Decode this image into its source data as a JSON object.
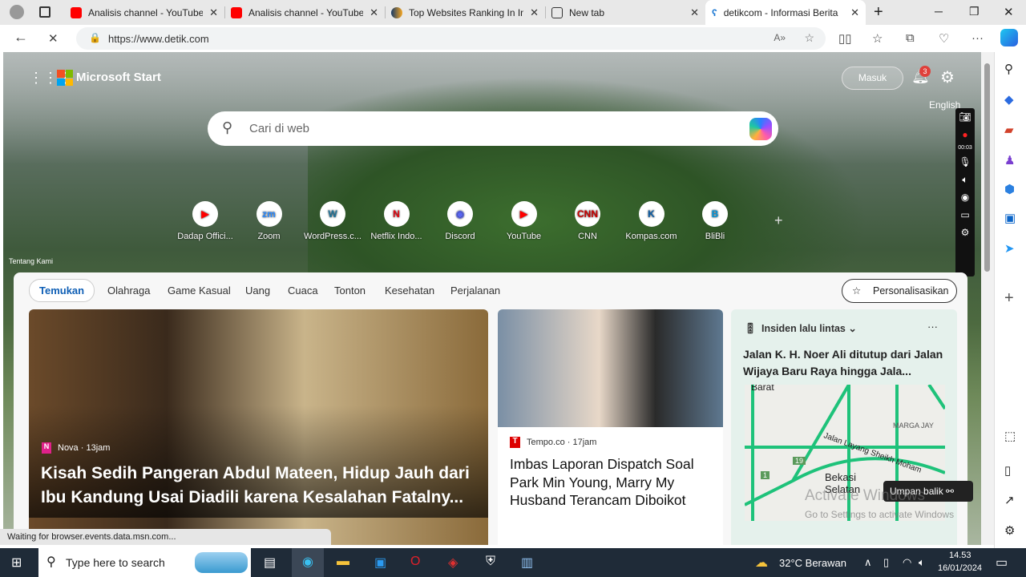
{
  "tabs": [
    {
      "title": "Analisis channel - YouTube S",
      "icon": "youtube-icon"
    },
    {
      "title": "Analisis channel - YouTube S",
      "icon": "youtube-icon"
    },
    {
      "title": "Top Websites Ranking In Ind",
      "icon": "similarweb-icon"
    },
    {
      "title": "New tab",
      "icon": "newtab-icon"
    },
    {
      "title": "detikcom - Informasi Berita",
      "icon": "detik-icon"
    }
  ],
  "address": {
    "url": "https://www.detik.com"
  },
  "start": {
    "brand": "Microsoft Start",
    "signin": "Masuk",
    "notif_count": "3",
    "language": "English",
    "search_placeholder": "Cari di web",
    "about": "Tentang Kami"
  },
  "quicklinks": [
    {
      "label": "Dadap Offici...",
      "glyph": "▶",
      "color": "#ff0000"
    },
    {
      "label": "Zoom",
      "glyph": "zm",
      "color": "#2d8cff"
    },
    {
      "label": "WordPress.c...",
      "glyph": "W",
      "color": "#21759b"
    },
    {
      "label": "Netflix Indo...",
      "glyph": "N",
      "color": "#e50914"
    },
    {
      "label": "Discord",
      "glyph": "◉",
      "color": "#5865f2"
    },
    {
      "label": "YouTube",
      "glyph": "▶",
      "color": "#ff0000"
    },
    {
      "label": "CNN",
      "glyph": "CNN",
      "color": "#cc0000"
    },
    {
      "label": "Kompas.com",
      "glyph": "K",
      "color": "#0b5ea8"
    },
    {
      "label": "BliBli",
      "glyph": "B",
      "color": "#0095da"
    }
  ],
  "recorder": {
    "timer": "00:03"
  },
  "feed": {
    "tabs": [
      "Temukan",
      "Olahraga",
      "Game Kasual",
      "Uang",
      "Cuaca",
      "Tonton",
      "Kesehatan",
      "Perjalanan"
    ],
    "personalize": "Personalisasikan",
    "main": {
      "source": "Nova · 13jam",
      "title": "Kisah Sedih Pangeran Abdul Mateen, Hidup Jauh dari Ibu Kandung Usai Diadili karena Kesalahan Fatalny..."
    },
    "second": {
      "source": "Tempo.co · 17jam",
      "title": "Imbas Laporan Dispatch Soal Park Min Young, Marry My Husband Terancam Diboikot"
    },
    "traffic": {
      "header": "Insiden lalu lintas",
      "title": "Jalan K. H. Noer Ali ditutup dari Jalan Wijaya Baru Raya hingga Jala...",
      "map_labels": [
        "Barat",
        "MARGA JAY",
        "Jalan Layang Sheikh Moham",
        "Bekasi Selatan",
        "19",
        "1"
      ]
    },
    "feedback": "Umpan balik"
  },
  "watermark": {
    "line1": "Activate Windows",
    "line2": "Go to Settings to activate Windows"
  },
  "status": "Waiting for browser.events.data.msn.com...",
  "taskbar": {
    "search": "Type here to search",
    "weather": "32°C  Berawan",
    "time": "14.53",
    "date": "16/01/2024"
  }
}
